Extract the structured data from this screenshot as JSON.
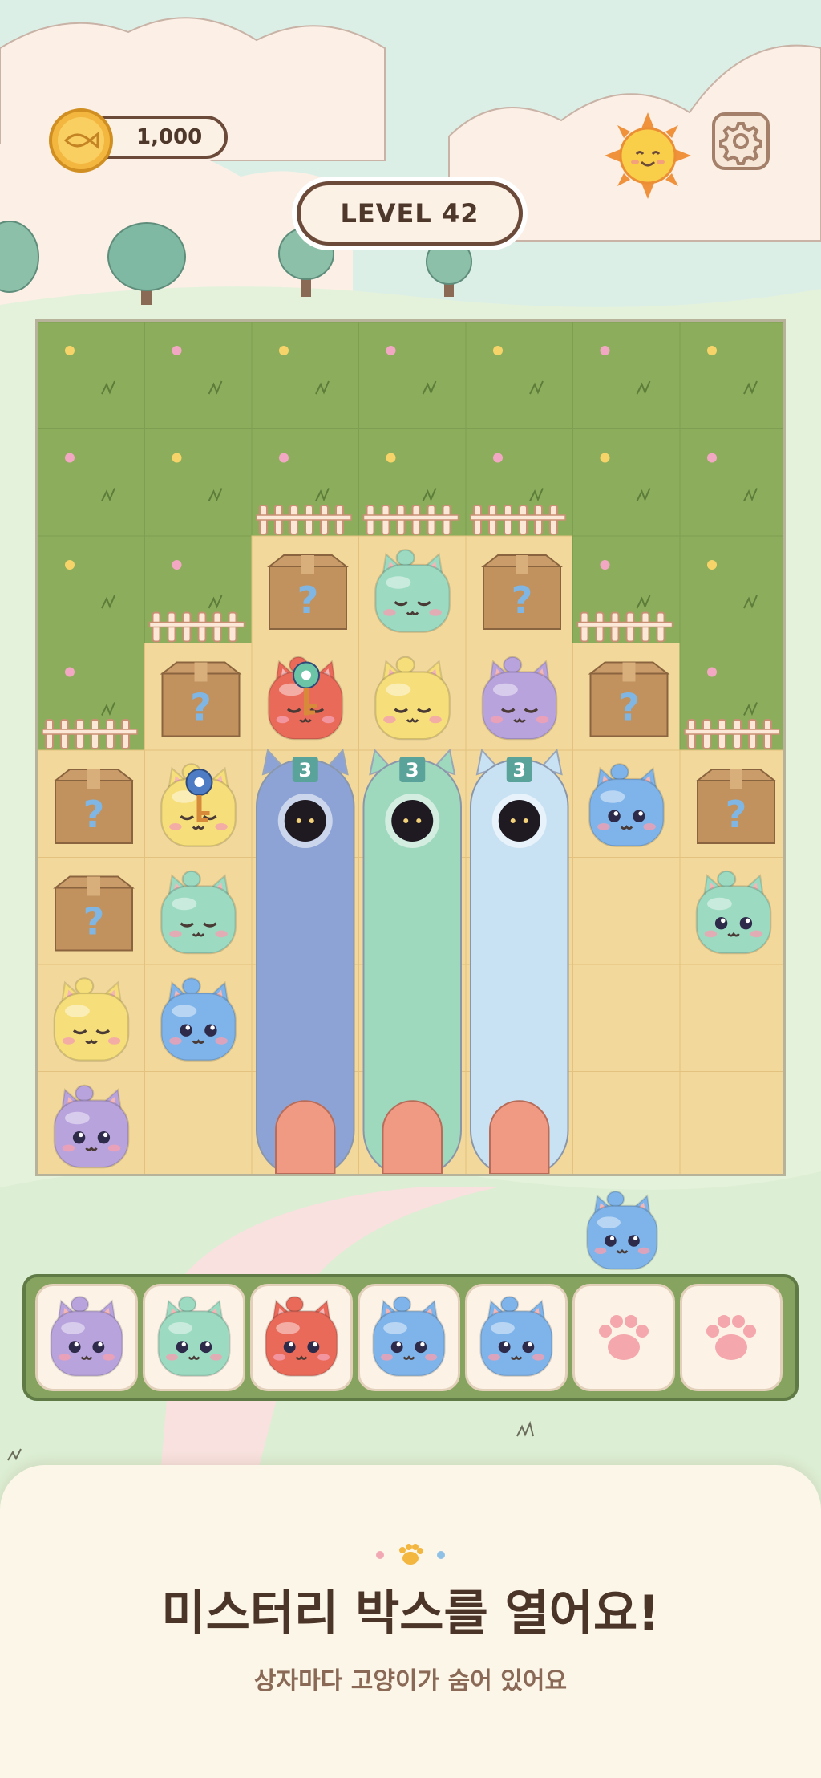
{
  "hud": {
    "coins": "1,000",
    "level": "LEVEL 42"
  },
  "icons": {
    "coin": "fish-coin-icon",
    "sun": "sun-icon",
    "settings": "gear-icon",
    "paw": "paw-icon",
    "mystery": "question-mark-icon",
    "key": "key-icon"
  },
  "board": {
    "columns": 7,
    "rows": 8,
    "tunnels": [
      {
        "count": "3",
        "color": "#8da3d6"
      },
      {
        "count": "3",
        "color": "#9ed9bd"
      },
      {
        "count": "3",
        "color": "#c9e2f3"
      }
    ],
    "pieces": [
      {
        "col": 2,
        "row": 2,
        "kind": "box"
      },
      {
        "col": 3,
        "row": 2,
        "kind": "cat",
        "color": "#9cdbc2",
        "face": "sleep"
      },
      {
        "col": 4,
        "row": 2,
        "kind": "box"
      },
      {
        "col": 1,
        "row": 3,
        "kind": "box"
      },
      {
        "col": 2,
        "row": 3,
        "kind": "cat",
        "color": "#ea6a5a",
        "face": "sleep",
        "key": "#6cc4a6"
      },
      {
        "col": 3,
        "row": 3,
        "kind": "cat",
        "color": "#f6df7b",
        "face": "sleep"
      },
      {
        "col": 4,
        "row": 3,
        "kind": "cat",
        "color": "#b9a3dd",
        "face": "sleep"
      },
      {
        "col": 5,
        "row": 3,
        "kind": "box"
      },
      {
        "col": 0,
        "row": 4,
        "kind": "box"
      },
      {
        "col": 1,
        "row": 4,
        "kind": "cat",
        "color": "#f6df7b",
        "face": "sleep",
        "key": "#4d7cc4"
      },
      {
        "col": 5,
        "row": 4,
        "kind": "cat",
        "color": "#7fb4ea",
        "face": "awake"
      },
      {
        "col": 6,
        "row": 4,
        "kind": "box"
      },
      {
        "col": 0,
        "row": 5,
        "kind": "box"
      },
      {
        "col": 1,
        "row": 5,
        "kind": "cat",
        "color": "#9cdbc2",
        "face": "sleep"
      },
      {
        "col": 6,
        "row": 5,
        "kind": "cat",
        "color": "#9cdbc2",
        "face": "awake"
      },
      {
        "col": 0,
        "row": 6,
        "kind": "cat",
        "color": "#f6df7b",
        "face": "sleep"
      },
      {
        "col": 1,
        "row": 6,
        "kind": "cat",
        "color": "#7fb4ea",
        "face": "awake"
      },
      {
        "col": 0,
        "row": 7,
        "kind": "cat",
        "color": "#b9a3dd",
        "face": "awake"
      }
    ]
  },
  "incoming_cat": {
    "color": "#7fb4ea"
  },
  "tray": {
    "slots": [
      {
        "kind": "cat",
        "color": "#b9a3dd"
      },
      {
        "kind": "cat",
        "color": "#9cdbc2"
      },
      {
        "kind": "cat",
        "color": "#ea6a5a"
      },
      {
        "kind": "cat",
        "color": "#7fb4ea"
      },
      {
        "kind": "cat",
        "color": "#7fb4ea"
      },
      {
        "kind": "empty"
      },
      {
        "kind": "empty"
      }
    ]
  },
  "panel": {
    "title": "미스터리 박스를 열어요!",
    "subtitle": "상자마다 고양이가 숨어 있어요"
  }
}
